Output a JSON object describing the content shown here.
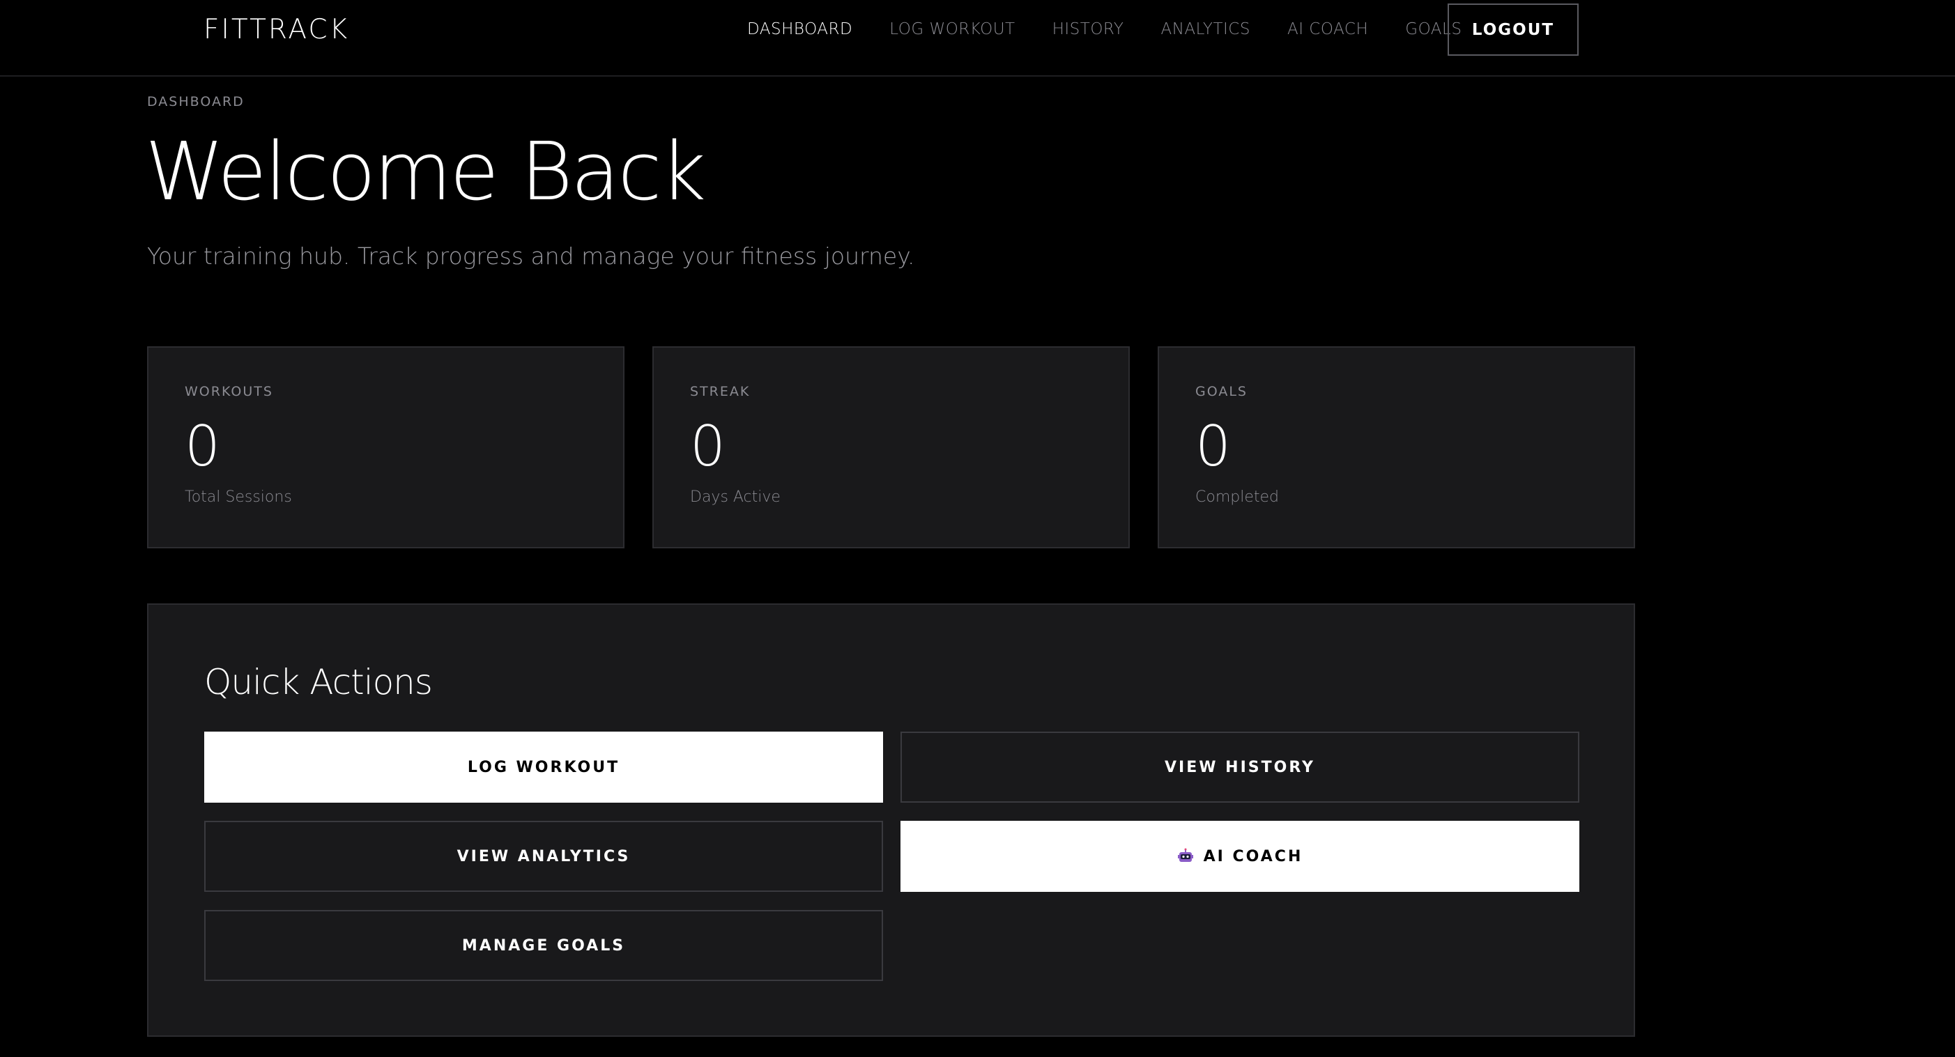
{
  "nav": {
    "brand": "FITTRACK",
    "links": [
      {
        "label": "DASHBOARD",
        "active": true
      },
      {
        "label": "LOG WORKOUT",
        "active": false
      },
      {
        "label": "HISTORY",
        "active": false
      },
      {
        "label": "ANALYTICS",
        "active": false
      },
      {
        "label": "AI COACH",
        "active": false
      },
      {
        "label": "GOALS",
        "active": false
      }
    ],
    "logout_label": "LOGOUT"
  },
  "header": {
    "breadcrumb": "DASHBOARD",
    "title": "Welcome Back",
    "subtitle": "Your training hub. Track progress and manage your fitness journey."
  },
  "stats": [
    {
      "label": "WORKOUTS",
      "value": "0",
      "caption": "Total Sessions"
    },
    {
      "label": "STREAK",
      "value": "0",
      "caption": "Days Active"
    },
    {
      "label": "GOALS",
      "value": "0",
      "caption": "Completed"
    }
  ],
  "quick_actions": {
    "title": "Quick Actions",
    "buttons": [
      {
        "label": "LOG WORKOUT",
        "style": "solid"
      },
      {
        "label": "VIEW HISTORY",
        "style": "outline"
      },
      {
        "label": "VIEW ANALYTICS",
        "style": "outline"
      },
      {
        "label": "AI COACH",
        "style": "solid",
        "icon": "robot-icon"
      },
      {
        "label": "MANAGE GOALS",
        "style": "outline"
      }
    ]
  },
  "colors": {
    "background": "#000000",
    "card": "#19191b",
    "card_border": "#2c2c30",
    "muted_text": "#8b8b92",
    "accent": "#ffffff"
  }
}
